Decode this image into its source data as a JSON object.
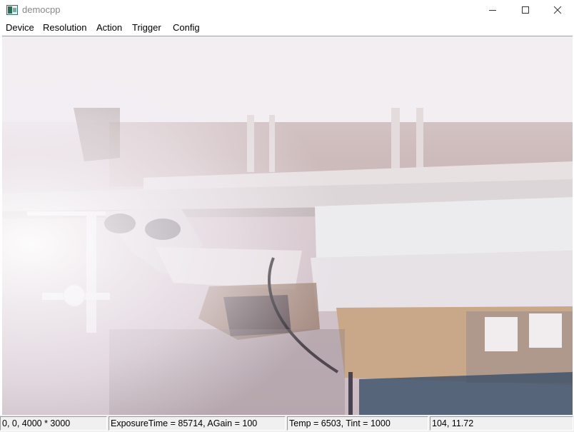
{
  "window": {
    "title": "democpp",
    "app_icon": "camera-app-icon"
  },
  "menu": {
    "items": [
      {
        "label": "Device"
      },
      {
        "label": "Resolution"
      },
      {
        "label": "Action"
      },
      {
        "label": "Trigger"
      },
      {
        "label": "Config"
      }
    ]
  },
  "status": {
    "roi": "0, 0, 4000 * 3000",
    "exposure": "ExposureTime = 85714, AGain = 100",
    "temp": "Temp = 6503, Tint = 1000",
    "fps": "104, 11.72"
  },
  "colors": {
    "accent": "#2b6b58",
    "overexposed_bg": "#f3eff5"
  }
}
